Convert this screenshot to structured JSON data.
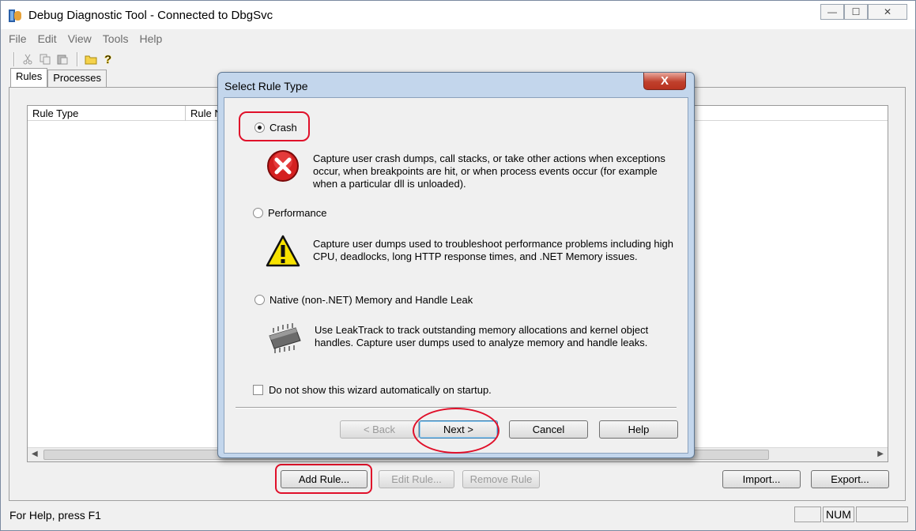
{
  "window": {
    "title": "Debug Diagnostic Tool - Connected to DbgSvc",
    "controls": {
      "minimize": "—",
      "maximize": "☐",
      "close": "✕"
    }
  },
  "menu": [
    "File",
    "Edit",
    "View",
    "Tools",
    "Help"
  ],
  "toolbar": {
    "icons": [
      "cut-icon",
      "copy-icon",
      "paste-icon",
      "open-folder-icon",
      "help-icon"
    ]
  },
  "tabs": [
    {
      "label": "Rules",
      "active": true
    },
    {
      "label": "Processes",
      "active": false
    }
  ],
  "rule_list": {
    "columns": [
      "Rule Type",
      "Rule N"
    ]
  },
  "buttons": {
    "add_rule": "Add Rule...",
    "edit_rule": "Edit Rule...",
    "remove_rule": "Remove Rule",
    "import": "Import...",
    "export": "Export..."
  },
  "status": {
    "text": "For Help, press F1",
    "num": "NUM"
  },
  "dialog": {
    "title": "Select Rule Type",
    "close": "X",
    "options": [
      {
        "label": "Crash",
        "checked": true,
        "icon": "error-icon",
        "description": "Capture user crash dumps, call stacks, or take other actions when exceptions occur, when breakpoints are hit, or when process events occur (for example when a particular dll is unloaded)."
      },
      {
        "label": "Performance",
        "checked": false,
        "icon": "warning-icon",
        "description": "Capture user dumps used to troubleshoot performance problems including high CPU, deadlocks, long HTTP response times, and .NET Memory issues."
      },
      {
        "label": "Native (non-.NET) Memory and Handle Leak",
        "checked": false,
        "icon": "memory-chip-icon",
        "description": "Use LeakTrack to track outstanding memory allocations and kernel object handles. Capture user dumps used to analyze memory and handle leaks."
      }
    ],
    "dont_show_label": "Do not show this wizard automatically on startup.",
    "buttons": {
      "back": "< Back",
      "next": "Next >",
      "cancel": "Cancel",
      "help": "Help"
    }
  },
  "colors": {
    "annotation": "#e0102a",
    "dialog_frame": "#c3d6ec"
  }
}
